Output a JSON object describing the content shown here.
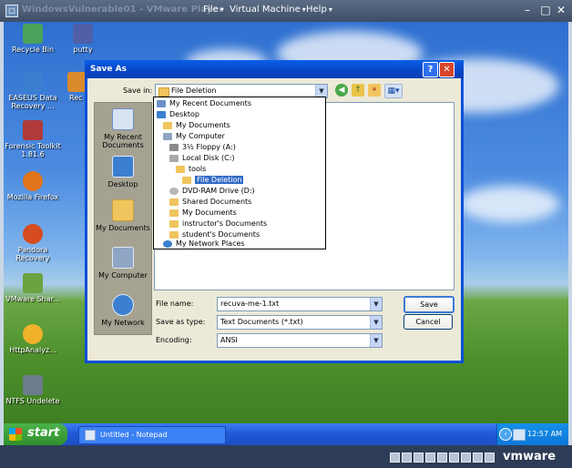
{
  "vmware": {
    "title": "WindowsVulnerable01 - VMware Player",
    "menus": [
      "File",
      "Virtual Machine",
      "Help"
    ],
    "controls": [
      "–",
      "□",
      "✕"
    ],
    "brand": "vmware"
  },
  "desktop": {
    "icons": [
      {
        "label": "Recycle Bin",
        "icon": "recycle-bin-icon",
        "color": "#4aa35a"
      },
      {
        "label": "putty",
        "icon": "putty-icon",
        "color": "#4f5fa8"
      },
      {
        "label": "EASEUS Data Recovery ...",
        "icon": "easeus-icon",
        "color": "#3b7fd0"
      },
      {
        "label": "Rec",
        "icon": "recovery-icon",
        "color": "#d98b2b"
      },
      {
        "label": "Forensic Toolkit 1.81.6",
        "icon": "forensic-toolkit-icon",
        "color": "#b03a3a"
      },
      {
        "label": "Mozilla Firefox",
        "icon": "firefox-icon",
        "color": "#e0741b"
      },
      {
        "label": "Pandora Recovery",
        "icon": "pandora-icon",
        "color": "#d64b1f"
      },
      {
        "label": "VMware Shar...",
        "icon": "vmware-share-icon",
        "color": "#6aa340"
      },
      {
        "label": "HttpAnalyz...",
        "icon": "httpanalyzer-icon",
        "color": "#f0b22b"
      },
      {
        "label": "NTFS Undelete",
        "icon": "ntfs-undelete-icon",
        "color": "#6c7b8d"
      }
    ]
  },
  "taskbar": {
    "start_label": "start",
    "task_label": "Untitled - Notepad",
    "clock": "12:57 AM"
  },
  "dialog": {
    "title": "Save As",
    "help_glyph": "?",
    "close_glyph": "✕",
    "save_in_label": "Save in:",
    "save_in_value": "File Deletion",
    "places": [
      "My Recent Documents",
      "Desktop",
      "My Documents",
      "My Computer",
      "My Network"
    ],
    "file_name_label": "File name:",
    "file_name_value": "recuva-me-1.txt",
    "save_as_type_label": "Save as type:",
    "save_as_type_value": "Text Documents (*.txt)",
    "encoding_label": "Encoding:",
    "encoding_value": "ANSI",
    "save_button": "Save",
    "cancel_button": "Cancel"
  },
  "dropdown": {
    "items": [
      {
        "label": "My Recent Documents",
        "icon": "recent-docs-icon",
        "color": "#6d8fc7",
        "level": 0
      },
      {
        "label": "Desktop",
        "icon": "desktop-icon",
        "color": "#3b7fd0",
        "level": 0
      },
      {
        "label": "My Documents",
        "icon": "folder-icon",
        "color": "#f1c55d",
        "level": 1
      },
      {
        "label": "My Computer",
        "icon": "computer-icon",
        "color": "#8ea6c4",
        "level": 1
      },
      {
        "label": "3½ Floppy (A:)",
        "icon": "floppy-icon",
        "color": "#8b8b8b",
        "level": 2
      },
      {
        "label": "Local Disk (C:)",
        "icon": "disk-icon",
        "color": "#a9a9a9",
        "level": 2
      },
      {
        "label": "tools",
        "icon": "folder-open-icon",
        "color": "#f1c55d",
        "level": 3
      },
      {
        "label": "File Deletion",
        "icon": "folder-open-icon",
        "color": "#f1c55d",
        "level": 4,
        "selected": true
      },
      {
        "label": "DVD-RAM Drive (D:)",
        "icon": "dvd-icon",
        "color": "#b7b7b7",
        "level": 2
      },
      {
        "label": "Shared Documents",
        "icon": "folder-icon",
        "color": "#f1c55d",
        "level": 2
      },
      {
        "label": "My Documents",
        "icon": "folder-icon",
        "color": "#f1c55d",
        "level": 2
      },
      {
        "label": "instructor's Documents",
        "icon": "folder-icon",
        "color": "#f1c55d",
        "level": 2
      },
      {
        "label": "student's Documents",
        "icon": "folder-icon",
        "color": "#f1c55d",
        "level": 2
      },
      {
        "label": "My Network Places",
        "icon": "network-icon",
        "color": "#3b7fd0",
        "level": 1
      }
    ]
  }
}
